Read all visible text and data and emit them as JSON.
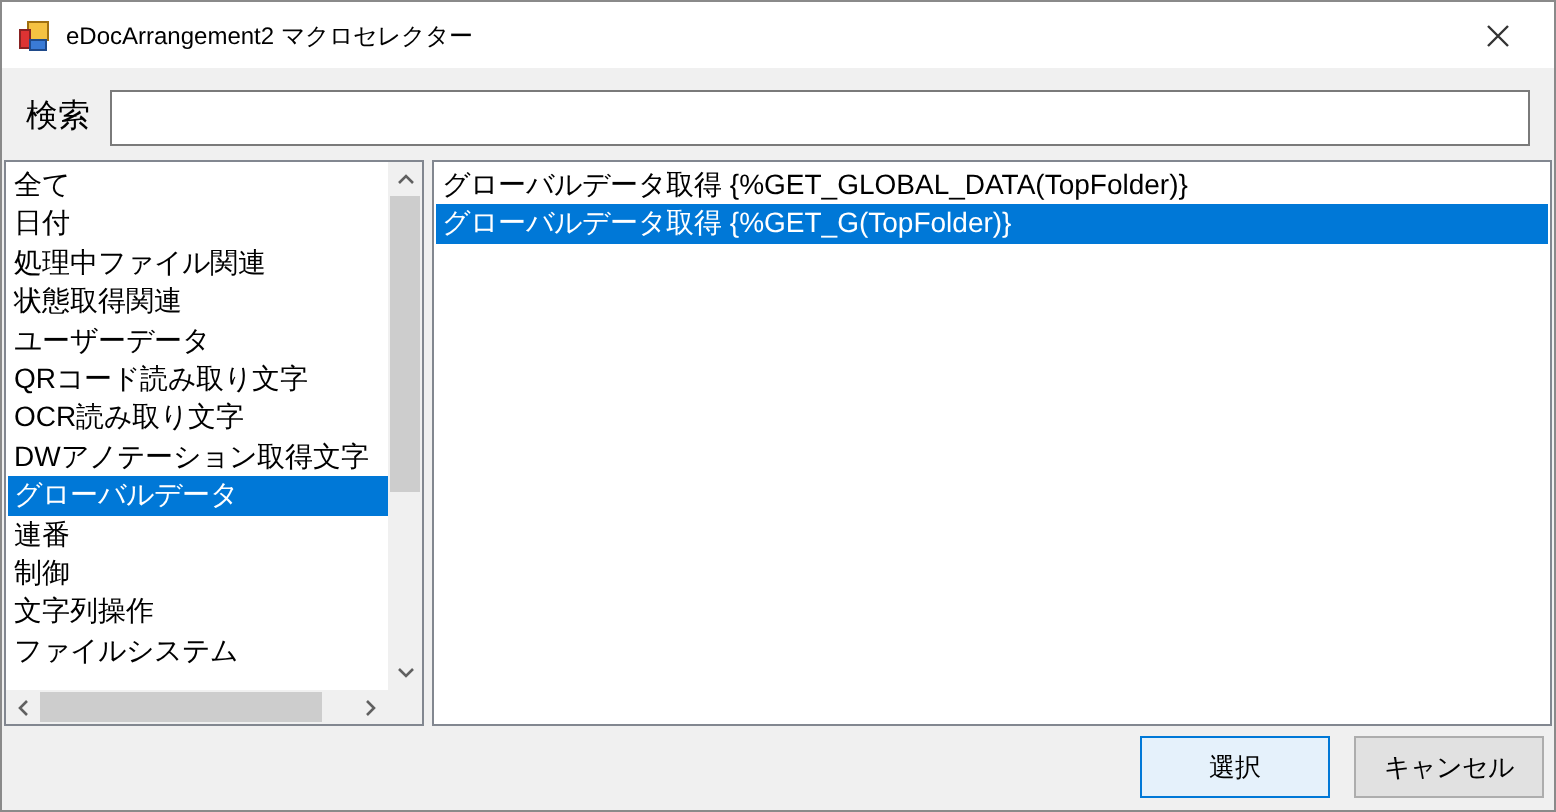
{
  "window": {
    "title": "eDocArrangement2 マクロセレクター"
  },
  "search": {
    "label": "検索"
  },
  "categories": [
    {
      "label": "全て",
      "selected": false
    },
    {
      "label": "日付",
      "selected": false
    },
    {
      "label": "処理中ファイル関連",
      "selected": false
    },
    {
      "label": "状態取得関連",
      "selected": false
    },
    {
      "label": "ユーザーデータ",
      "selected": false
    },
    {
      "label": "QRコード読み取り文字",
      "selected": false
    },
    {
      "label": "OCR読み取り文字",
      "selected": false
    },
    {
      "label": "DWアノテーション取得文字",
      "selected": false
    },
    {
      "label": "グローバルデータ",
      "selected": true
    },
    {
      "label": "連番",
      "selected": false
    },
    {
      "label": "制御",
      "selected": false
    },
    {
      "label": "文字列操作",
      "selected": false
    },
    {
      "label": "ファイルシステム",
      "selected": false
    }
  ],
  "macros": [
    {
      "label": "グローバルデータ取得 {%GET_GLOBAL_DATA(TopFolder)}",
      "selected": false
    },
    {
      "label": "グローバルデータ取得 {%GET_G(TopFolder)}",
      "selected": true
    }
  ],
  "buttons": [
    {
      "label": "選択",
      "kind": "default"
    },
    {
      "label": "キャンセル",
      "kind": "normal"
    }
  ]
}
